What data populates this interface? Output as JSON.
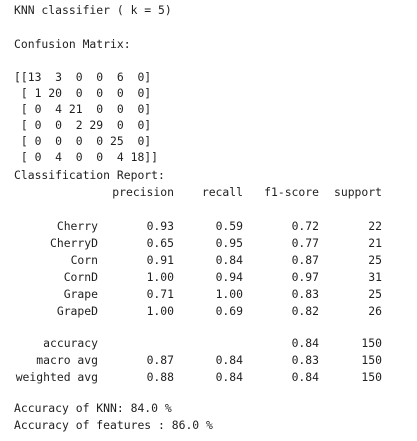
{
  "output": {
    "title": "KNN classifier ( k = 5)",
    "confusion_heading": "Confusion Matrix:",
    "confusion_rows": [
      "[[13  3  0  0  6  0]",
      " [ 1 20  0  0  0  0]",
      " [ 0  4 21  0  0  0]",
      " [ 0  0  2 29  0  0]",
      " [ 0  0  0  0 25  0]",
      " [ 0  4  0  0  4 18]]"
    ],
    "report_heading": "Classification Report:",
    "report_headers": [
      "precision",
      "recall",
      "f1-score",
      "support"
    ],
    "report_classes": [
      {
        "label": "Cherry",
        "precision": "0.93",
        "recall": "0.59",
        "f1": "0.72",
        "support": "22"
      },
      {
        "label": "CherryD",
        "precision": "0.65",
        "recall": "0.95",
        "f1": "0.77",
        "support": "21"
      },
      {
        "label": "Corn",
        "precision": "0.91",
        "recall": "0.84",
        "f1": "0.87",
        "support": "25"
      },
      {
        "label": "CornD",
        "precision": "1.00",
        "recall": "0.94",
        "f1": "0.97",
        "support": "31"
      },
      {
        "label": "Grape",
        "precision": "0.71",
        "recall": "1.00",
        "f1": "0.83",
        "support": "25"
      },
      {
        "label": "GrapeD",
        "precision": "1.00",
        "recall": "0.69",
        "f1": "0.82",
        "support": "26"
      }
    ],
    "report_summary": [
      {
        "label": "accuracy",
        "precision": "",
        "recall": "",
        "f1": "0.84",
        "support": "150"
      },
      {
        "label": "macro avg",
        "precision": "0.87",
        "recall": "0.84",
        "f1": "0.83",
        "support": "150"
      },
      {
        "label": "weighted avg",
        "precision": "0.88",
        "recall": "0.84",
        "f1": "0.84",
        "support": "150"
      }
    ],
    "knn_accuracy": "Accuracy of KNN: 84.0 %",
    "features_accuracy": "Accuracy of features : 86.0 %"
  }
}
